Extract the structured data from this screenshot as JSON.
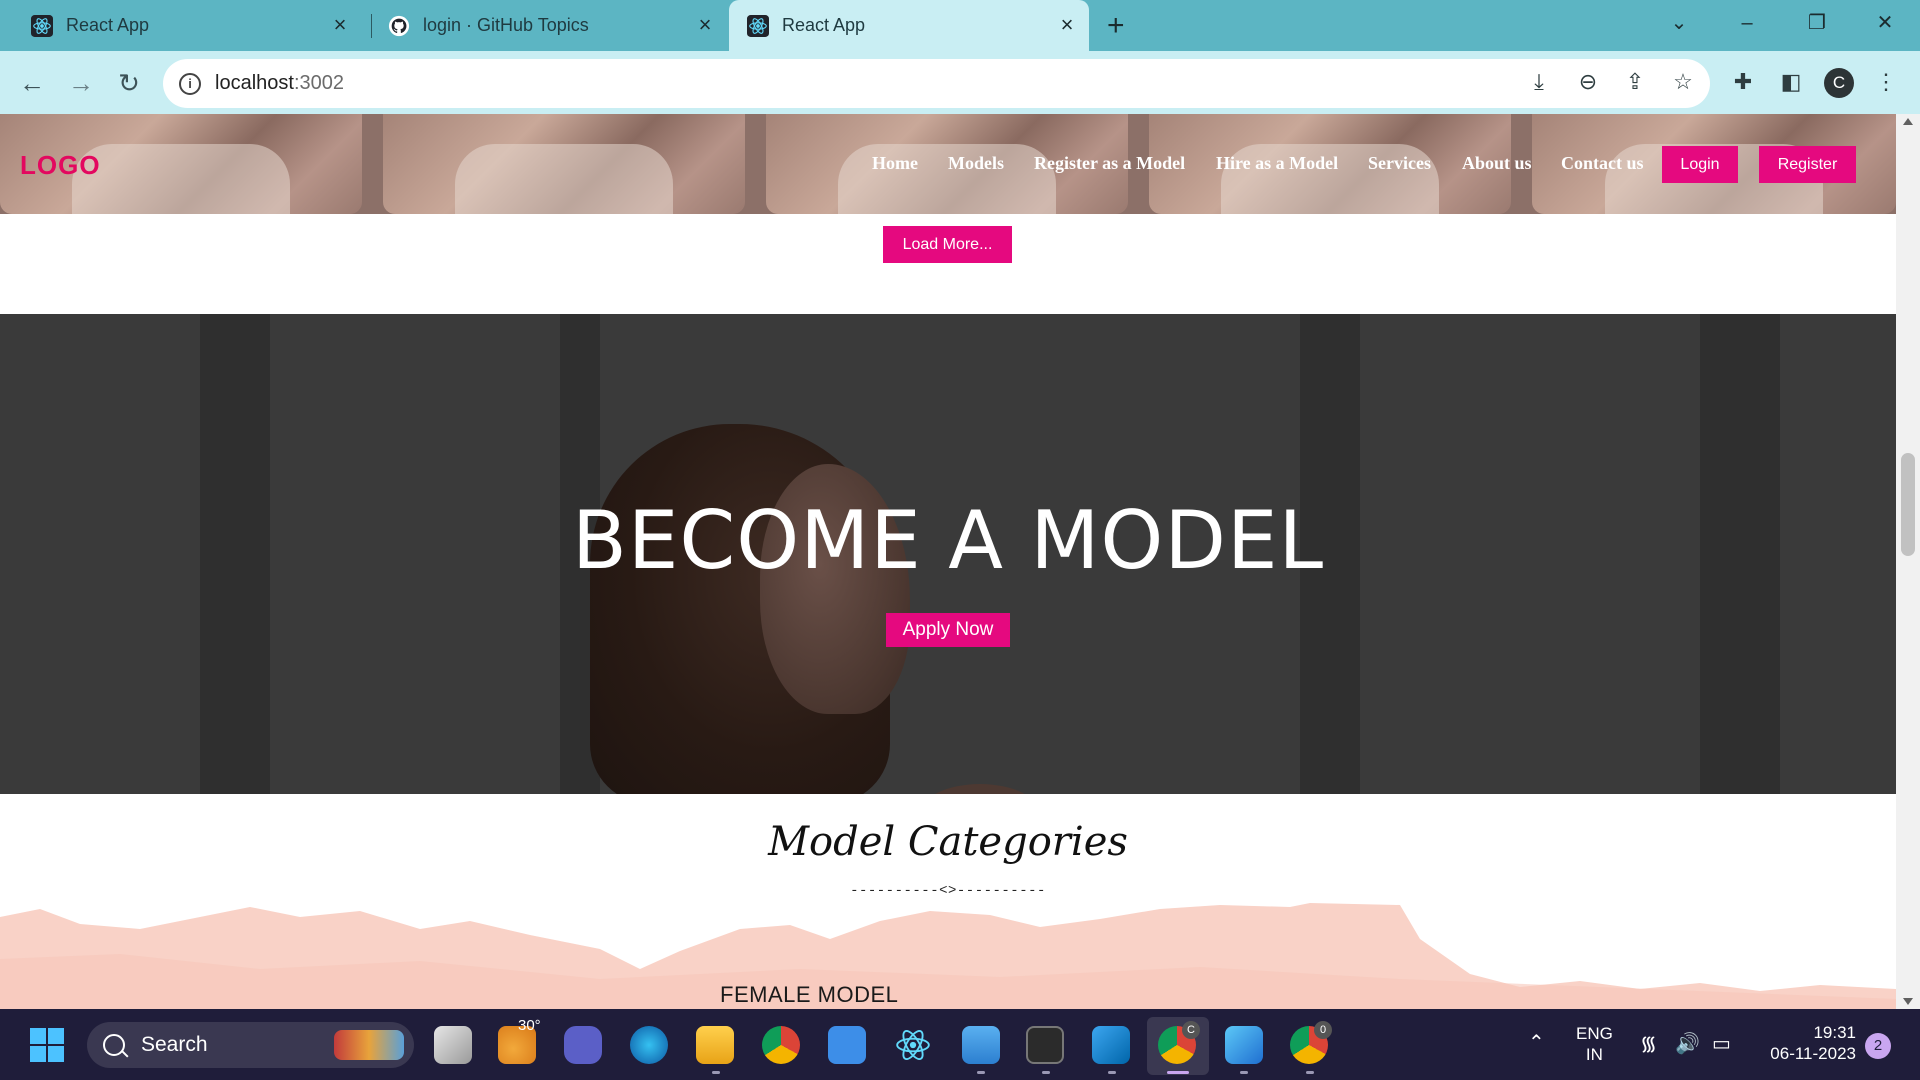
{
  "browser": {
    "tabs": [
      {
        "title": "React App",
        "icon": "react-icon",
        "active": false
      },
      {
        "title": "login · GitHub Topics",
        "icon": "github-icon",
        "active": false
      },
      {
        "title": "React App",
        "icon": "react-icon",
        "active": true
      }
    ],
    "new_tab": "+",
    "url_host": "localhost",
    "url_port": ":3002",
    "profile_initial": "C"
  },
  "site": {
    "logo": "LOGO",
    "nav": [
      "Home",
      "Models",
      "Register as a Model",
      "Hire as a Model",
      "Services",
      "About us",
      "Contact us"
    ],
    "login_label": "Login",
    "register_label": "Register",
    "load_more_label": "Load More...",
    "hero_title": "BECOME A MODEL",
    "apply_label": "Apply Now",
    "categories_title": "Model Categories",
    "categories_divider": "----------<>----------",
    "female_label": "FEMALE MODEL",
    "accent_color": "#e5097f"
  },
  "taskbar": {
    "search_label": "Search",
    "weather": "30°",
    "lang_top": "ENG",
    "lang_bottom": "IN",
    "time": "19:31",
    "date": "06-11-2023",
    "notifications": "2",
    "chrome_badge_1": "C",
    "chrome_badge_2": "0"
  }
}
